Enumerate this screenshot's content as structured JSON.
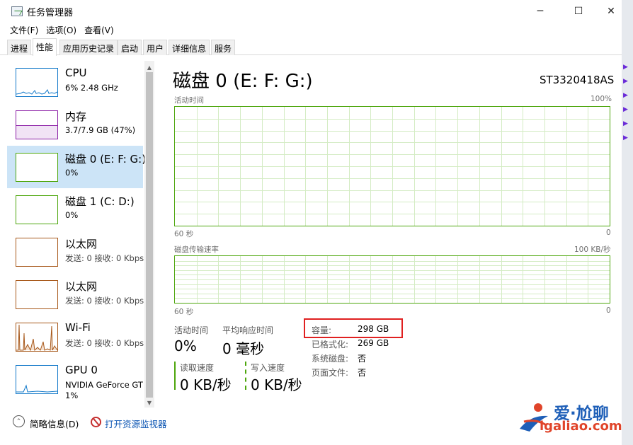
{
  "window": {
    "title": "任务管理器",
    "minimize": "─",
    "maximize": "☐",
    "close": "✕"
  },
  "menu": [
    "文件(F)",
    "选项(O)",
    "查看(V)"
  ],
  "tabs": [
    {
      "label": "进程",
      "active": false
    },
    {
      "label": "性能",
      "active": true
    },
    {
      "label": "应用历史记录",
      "active": false
    },
    {
      "label": "启动",
      "active": false
    },
    {
      "label": "用户",
      "active": false
    },
    {
      "label": "详细信息",
      "active": false
    },
    {
      "label": "服务",
      "active": false
    }
  ],
  "sidebar": [
    {
      "name": "CPU",
      "sub": "6% 2.48 GHz",
      "color": "#1178c9",
      "selected": false
    },
    {
      "name": "内存",
      "sub": "3.7/7.9 GB (47%)",
      "color": "#8b1fa5",
      "selected": false
    },
    {
      "name": "磁盘 0 (E: F: G:)",
      "sub": "0%",
      "color": "#4da60c",
      "selected": true
    },
    {
      "name": "磁盘 1 (C: D:)",
      "sub": "0%",
      "color": "#4da60c",
      "selected": false
    },
    {
      "name": "以太网",
      "sub": "发送: 0 接收: 0 Kbps",
      "color": "#a7581a",
      "selected": false
    },
    {
      "name": "以太网",
      "sub": "发送: 0 接收: 0 Kbps",
      "color": "#a7581a",
      "selected": false
    },
    {
      "name": "Wi-Fi",
      "sub": "发送: 0 接收: 0 Kbps",
      "color": "#a7581a",
      "selected": false
    },
    {
      "name": "GPU 0",
      "sub": "NVIDIA GeForce GT",
      "sub2": "1%",
      "color": "#1178c9",
      "selected": false
    }
  ],
  "main": {
    "title": "磁盘 0 (E: F: G:)",
    "model": "ST3320418AS",
    "active_time_label": "活动时间",
    "active_time_max": "100%",
    "time_axis": "60 秒",
    "axis_zero": "0",
    "transfer_label": "磁盘传输速率",
    "transfer_max": "100 KB/秒",
    "graph_color": "#4da60c",
    "stats": {
      "active_time_label": "活动时间",
      "active_time_value": "0%",
      "avg_response_label": "平均响应时间",
      "avg_response_value": "0 毫秒",
      "read_label": "读取速度",
      "read_value": "0 KB/秒",
      "write_label": "写入速度",
      "write_value": "0 KB/秒"
    },
    "specs": [
      {
        "label": "容量:",
        "value": "298 GB"
      },
      {
        "label": "已格式化:",
        "value": "269 GB"
      },
      {
        "label": "系统磁盘:",
        "value": "否"
      },
      {
        "label": "页面文件:",
        "value": "否"
      }
    ],
    "highlight_color": "#e02020"
  },
  "footer": {
    "summary": "简略信息(D)",
    "resource_monitor": "打开资源监视器"
  },
  "watermark": {
    "brand": "爱·尬聊",
    "url": "igaliao.com"
  }
}
